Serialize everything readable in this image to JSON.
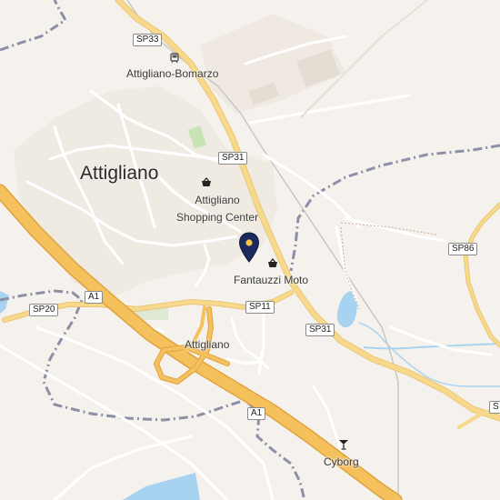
{
  "map": {
    "colors": {
      "background": "#f5f2ed",
      "motorway": "#f4c15c",
      "primary_road": "#f8d88a",
      "minor_road": "#ffffff",
      "water": "#a8d3f0",
      "boundary": "#8c8fa6",
      "pin": "#1a2a5e"
    },
    "places": [
      {
        "id": "attigliano-town",
        "name": "Attigliano"
      },
      {
        "id": "attigliano-bomarzo-station",
        "name": "Attigliano-Bomarzo",
        "icon": "train-station-icon"
      },
      {
        "id": "attigliano-shopping-center",
        "name": "Attigliano\nShopping Center",
        "icon": "shopping-basket-icon"
      },
      {
        "id": "fantauzzi-moto",
        "name": "Fantauzzi Moto",
        "icon": "shopping-basket-icon"
      },
      {
        "id": "attigliano-interchange",
        "name": "Attigliano"
      },
      {
        "id": "cyborg",
        "name": "Cyborg",
        "icon": "cocktail-bar-icon"
      }
    ],
    "road_shields": [
      {
        "id": "sp33",
        "ref": "SP33"
      },
      {
        "id": "sp31-north",
        "ref": "SP31"
      },
      {
        "id": "sp31-south",
        "ref": "SP31"
      },
      {
        "id": "sp11",
        "ref": "SP11"
      },
      {
        "id": "sp20",
        "ref": "SP20"
      },
      {
        "id": "sp86",
        "ref": "SP86"
      },
      {
        "id": "a1-north",
        "ref": "A1"
      },
      {
        "id": "a1-south",
        "ref": "A1"
      },
      {
        "id": "s-cut",
        "ref": "S"
      }
    ],
    "selected_marker": {
      "icon": "location-pin-icon"
    }
  }
}
